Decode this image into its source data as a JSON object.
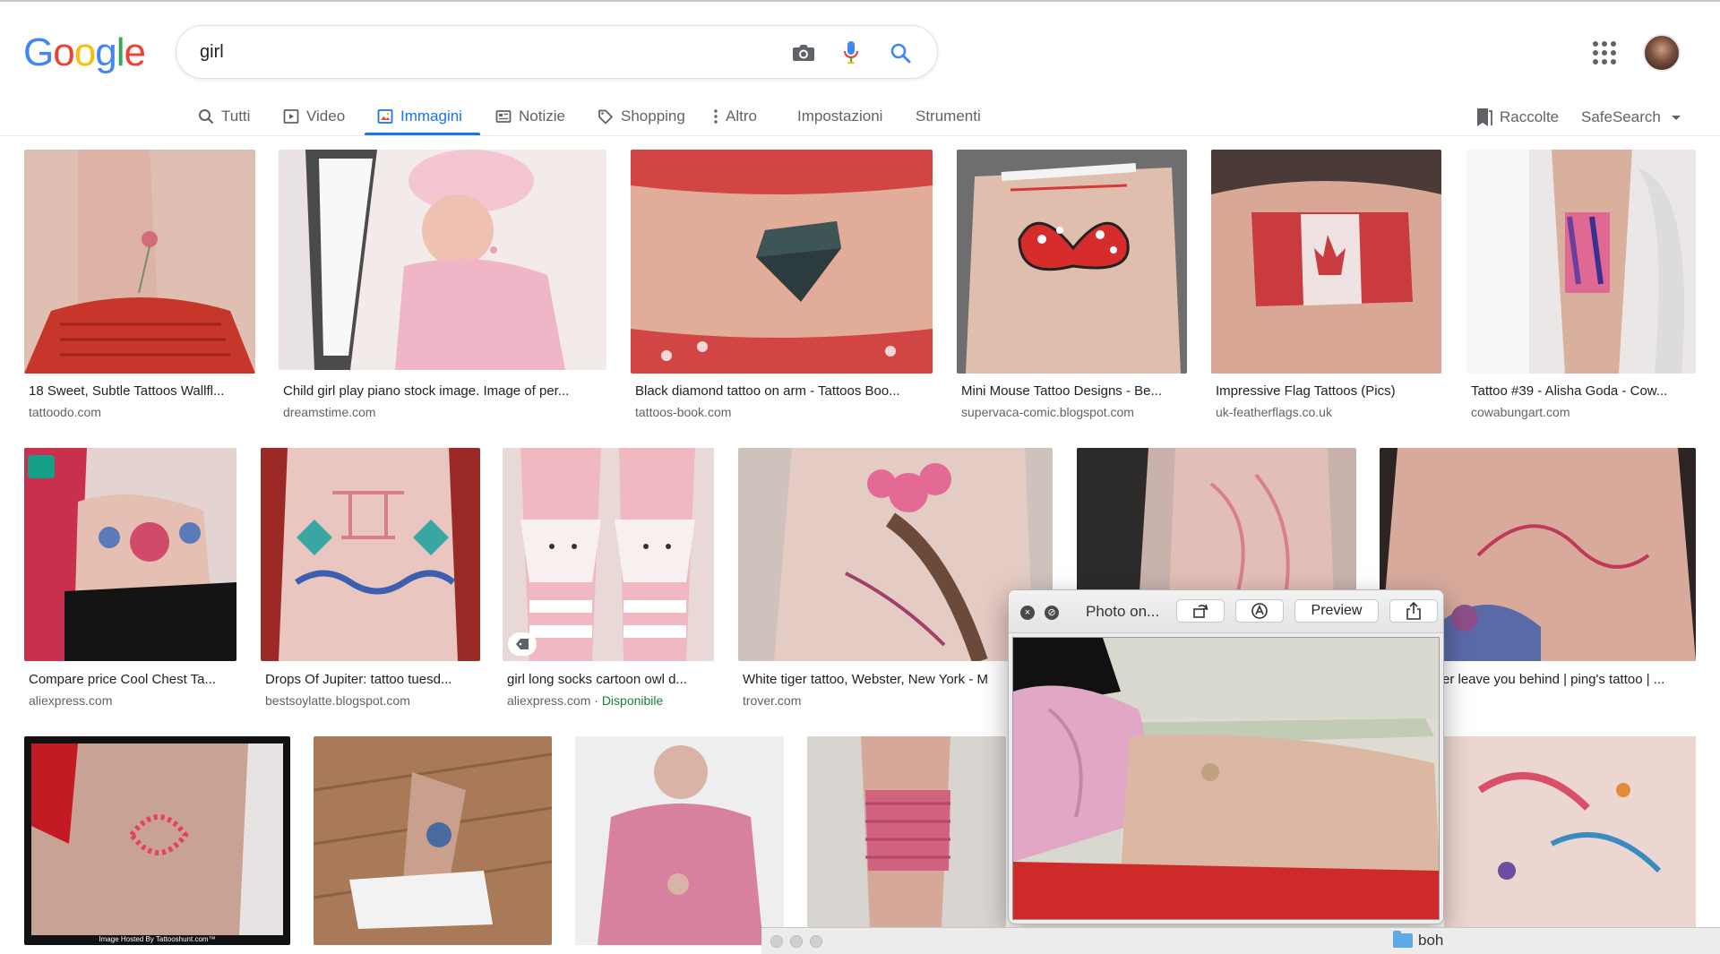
{
  "header": {
    "logo": [
      "G",
      "o",
      "o",
      "g",
      "l",
      "e"
    ],
    "logo_colors": [
      "#4285f4",
      "#ea4335",
      "#fbbc05",
      "#4285f4",
      "#34a853",
      "#ea4335"
    ],
    "search_value": "girl"
  },
  "tabs": [
    {
      "label": "Tutti",
      "icon": "search-icon"
    },
    {
      "label": "Video",
      "icon": "video-icon"
    },
    {
      "label": "Immagini",
      "icon": "image-icon",
      "active": true
    },
    {
      "label": "Notizie",
      "icon": "news-icon"
    },
    {
      "label": "Shopping",
      "icon": "tag-icon"
    },
    {
      "label": "Altro",
      "icon": "more-vert-icon"
    },
    {
      "label": "Impostazioni"
    },
    {
      "label": "Strumenti"
    }
  ],
  "right_tools": {
    "collections": "Raccolte",
    "safesearch": "SafeSearch"
  },
  "results": [
    {
      "caption": "18 Sweet, Subtle Tattoos Wallfl...",
      "source": "tattoodo.com"
    },
    {
      "caption": "Child girl play piano stock image. Image of per...",
      "source": "dreamstime.com"
    },
    {
      "caption": "Black diamond tattoo on arm - Tattoos Boo...",
      "source": "tattoos-book.com"
    },
    {
      "caption": "Mini Mouse Tattoo Designs - Be...",
      "source": "supervaca-comic.blogspot.com"
    },
    {
      "caption": "Impressive Flag Tattoos (Pics)",
      "source": "uk-featherflags.co.uk"
    },
    {
      "caption": "Tattoo #39 - Alisha Goda - Cow...",
      "source": "cowabungart.com"
    },
    {
      "caption": "Compare price Cool Chest Ta...",
      "source": "aliexpress.com"
    },
    {
      "caption": "Drops Of Jupiter: tattoo tuesd...",
      "source": "bestsoylatte.blogspot.com"
    },
    {
      "caption": "girl long socks cartoon owl d...",
      "source": "aliexpress.com",
      "availability": " · Disponibile"
    },
    {
      "caption": "White tiger tattoo, Webster, New York - M",
      "source": "trover.com"
    },
    {
      "caption": "",
      "source": ""
    },
    {
      "caption": "er leave you behind | ping's tattoo | ...",
      "source": ""
    },
    {
      "caption": "",
      "source": "",
      "watermark": "Image Hosted By Tattooshunt.com™"
    },
    {
      "caption": "",
      "source": ""
    },
    {
      "caption": "",
      "source": ""
    },
    {
      "caption": "",
      "source": ""
    },
    {
      "caption": "",
      "source": ""
    }
  ],
  "preview_window": {
    "title": "Photo on...",
    "preview_label": "Preview"
  },
  "finder": {
    "folder_label": "boh"
  }
}
